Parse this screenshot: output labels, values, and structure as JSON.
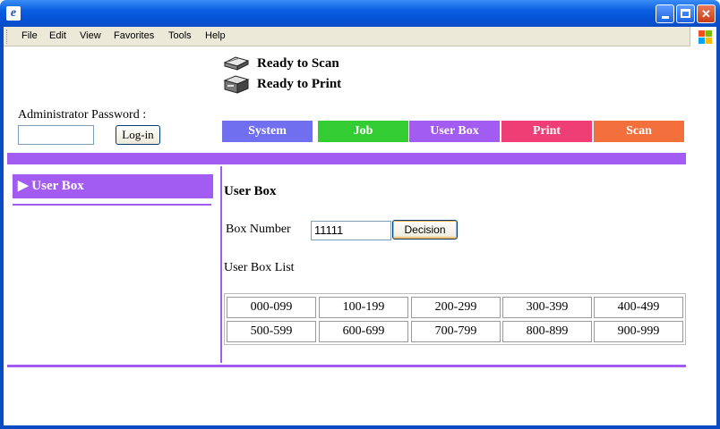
{
  "window": {
    "app_icon": "internet-explorer-icon",
    "controls": {
      "minimize": "minimize-icon",
      "maximize": "maximize-icon",
      "close": "✕"
    }
  },
  "menu": [
    "File",
    "Edit",
    "View",
    "Favorites",
    "Tools",
    "Help"
  ],
  "status": {
    "scan": "Ready to Scan",
    "print": "Ready to Print"
  },
  "admin": {
    "label": "Administrator Password :",
    "password_value": "",
    "login_button": "Log-in"
  },
  "tabs": [
    {
      "label": "System",
      "color": "#6f6ff0"
    },
    {
      "label": "Job",
      "color": "#33cc33"
    },
    {
      "label": "User Box",
      "color": "#a25cf2"
    },
    {
      "label": "Print",
      "color": "#ef3d75"
    },
    {
      "label": "Scan",
      "color": "#f36f3b"
    }
  ],
  "sidebar": {
    "items": [
      {
        "label": "▶ User Box"
      }
    ]
  },
  "main": {
    "title": "User Box",
    "box_number_label": "Box Number",
    "box_number_value": "11111",
    "decision_button": "Decision",
    "list_label": "User Box List",
    "ranges": [
      [
        "000-099",
        "100-199",
        "200-299",
        "300-399",
        "400-499"
      ],
      [
        "500-599",
        "600-699",
        "700-799",
        "800-899",
        "900-999"
      ]
    ]
  },
  "colors": {
    "accent": "#a25cf2",
    "titlebar": "#0a5ee0"
  }
}
